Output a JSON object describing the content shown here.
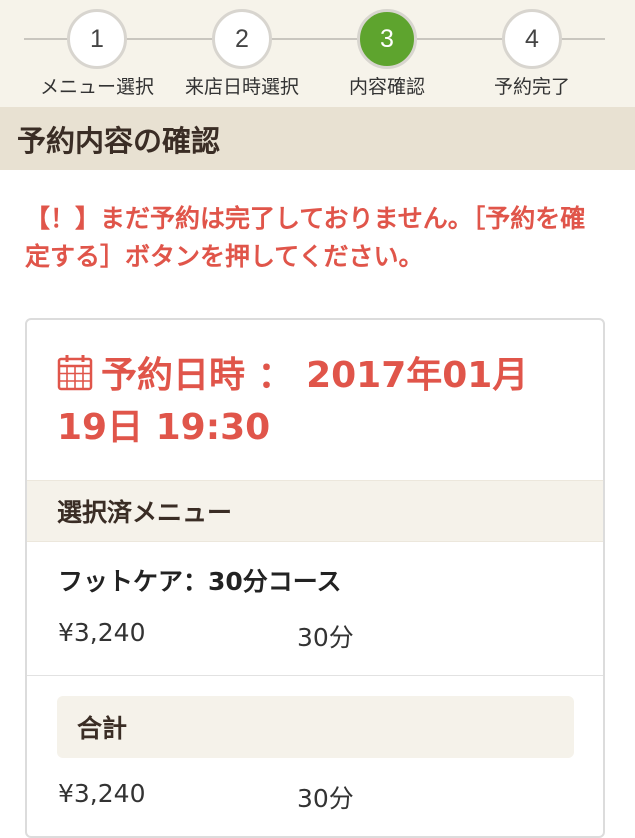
{
  "stepper": {
    "steps": [
      {
        "number": "1",
        "label": "メニュー選択"
      },
      {
        "number": "2",
        "label": "来店日時選択"
      },
      {
        "number": "3",
        "label": "内容確認"
      },
      {
        "number": "4",
        "label": "予約完了"
      }
    ],
    "active_index": 2,
    "active_color": "#5ea42e"
  },
  "section": {
    "title": "予約内容の確認"
  },
  "warning": {
    "text": "【！】まだ予約は完了しておりません。［予約を確定する］ボタンを押してください。",
    "color": "#e0554a"
  },
  "reservation": {
    "datetime_label": "予約日時 ： 2017年01月19日 19:30",
    "icon": "calendar-icon"
  },
  "menu": {
    "header": "選択済メニュー",
    "items": [
      {
        "name": "フットケア：30分コース",
        "price": "¥3,240",
        "duration": "30分"
      }
    ]
  },
  "total": {
    "label": "合計",
    "price": "¥3,240",
    "duration": "30分"
  }
}
